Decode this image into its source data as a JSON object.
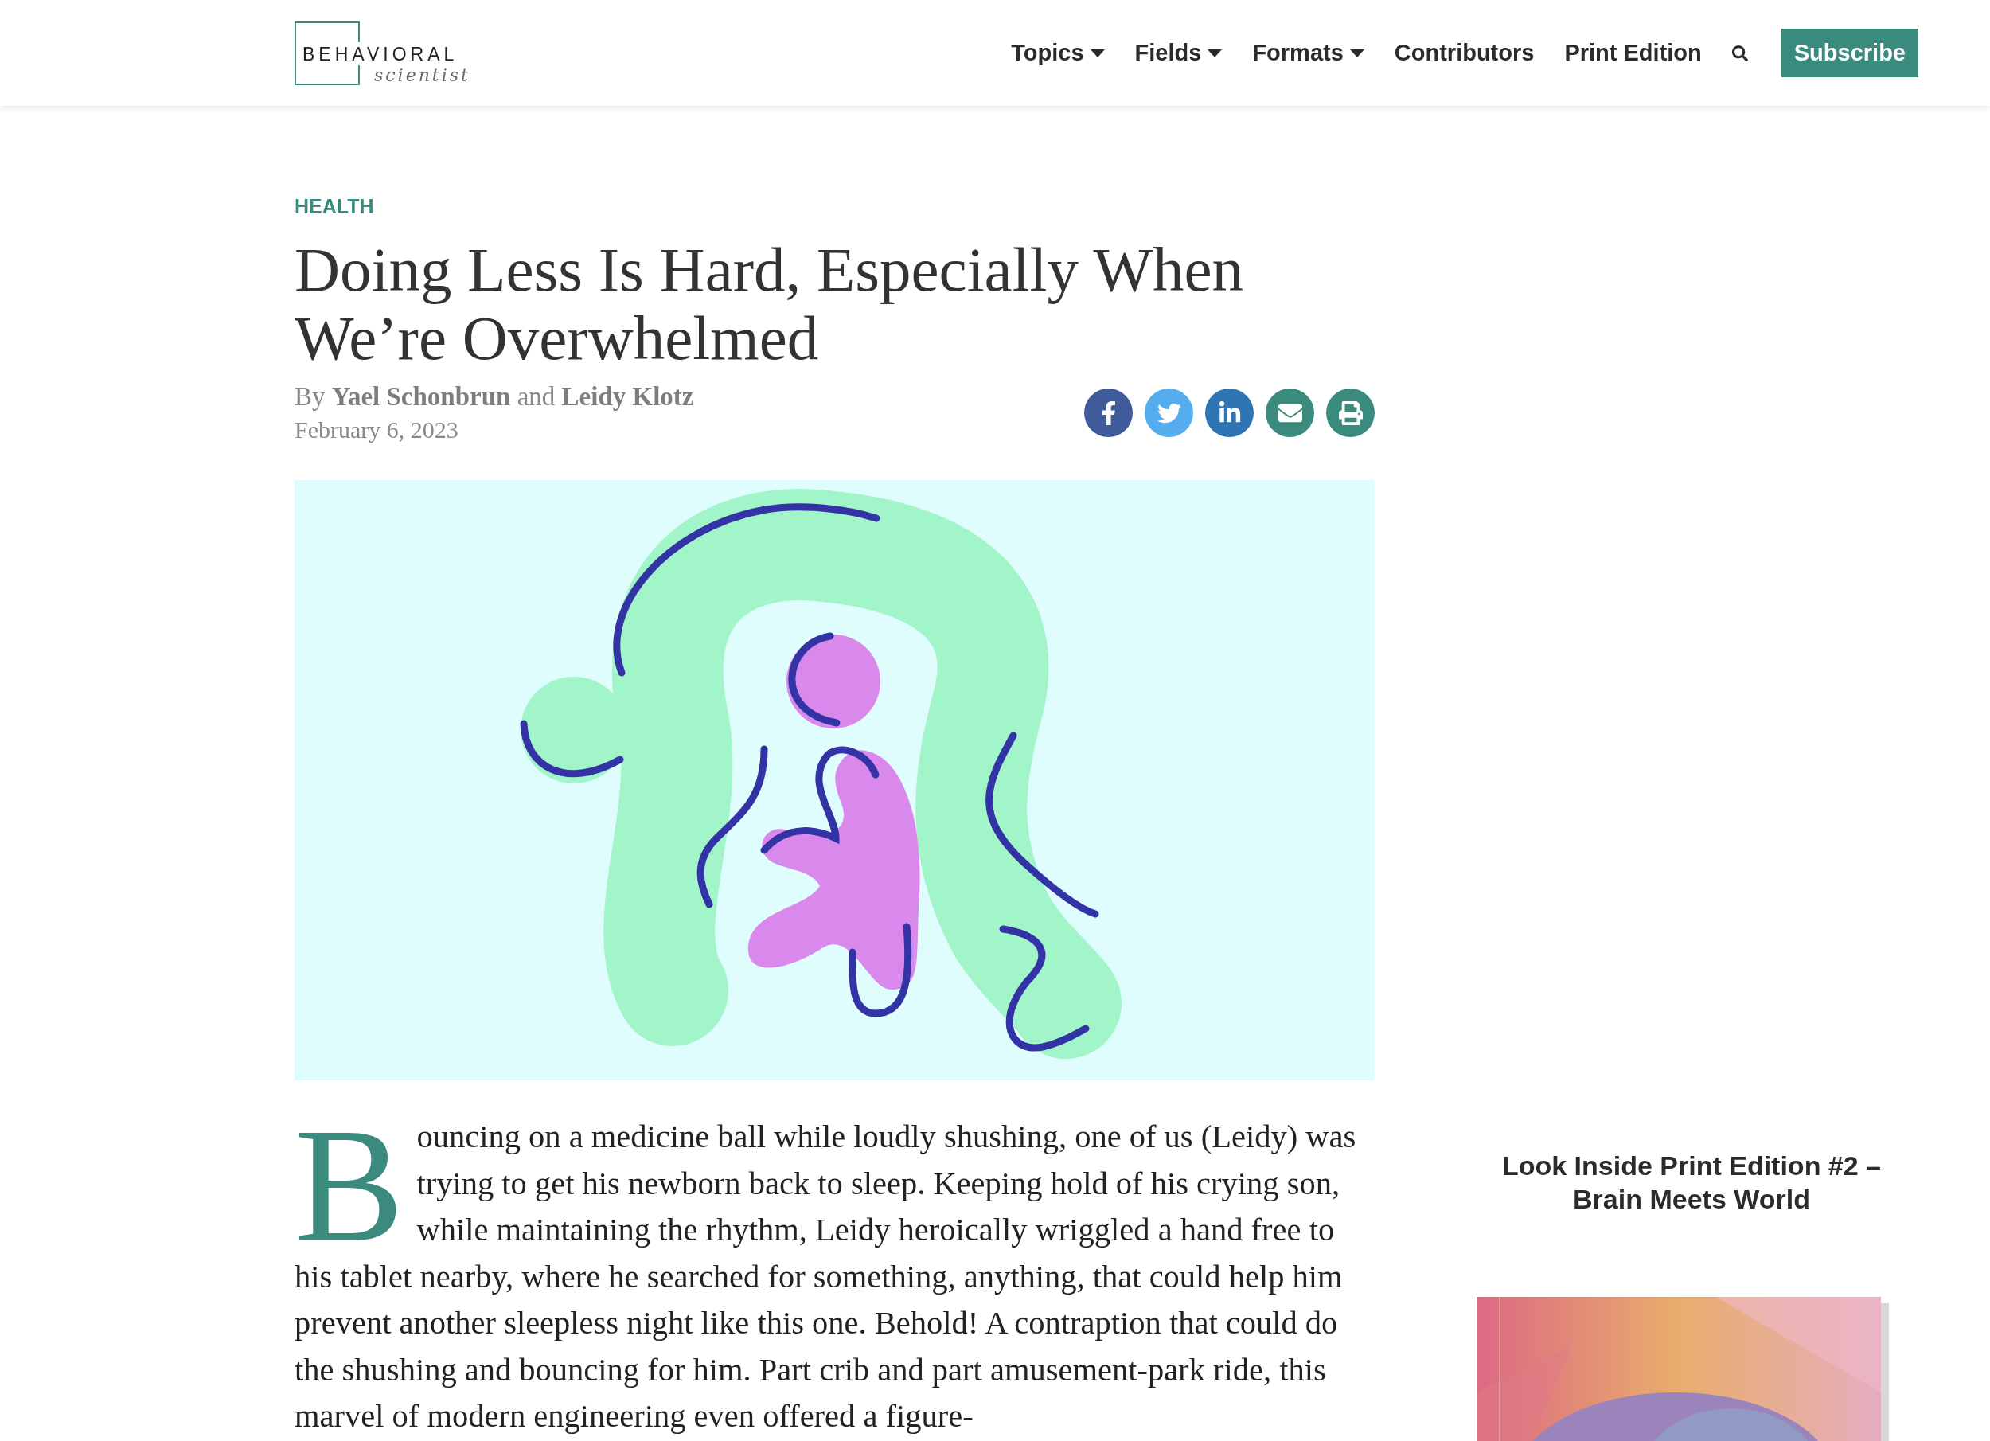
{
  "header": {
    "logo": {
      "line1": "BEHAVIORAL",
      "line2": "scientist"
    },
    "nav": [
      {
        "label": "Topics",
        "has_menu": true
      },
      {
        "label": "Fields",
        "has_menu": true
      },
      {
        "label": "Formats",
        "has_menu": true
      },
      {
        "label": "Contributors",
        "has_menu": false
      },
      {
        "label": "Print Edition",
        "has_menu": false
      }
    ],
    "subscribe": "Subscribe"
  },
  "article": {
    "category": "HEALTH",
    "title": "Doing Less Is Hard, Especially When We’re Overwhelmed",
    "byline": {
      "by": "By",
      "authors": [
        "Yael Schonbrun",
        "Leidy Klotz"
      ],
      "joiner": "and"
    },
    "date": "February 6, 2023",
    "share": [
      {
        "kind": "facebook",
        "color": "#3f5b99"
      },
      {
        "kind": "twitter",
        "color": "#55aded"
      },
      {
        "kind": "linkedin",
        "color": "#2f74b3"
      },
      {
        "kind": "email",
        "color": "#3a8a7e"
      },
      {
        "kind": "print",
        "color": "#3a8a7e"
      }
    ],
    "drop_cap": "B",
    "body": "ouncing on a medicine ball while loudly shushing, one of us (Leidy) was trying to get his newborn back to sleep. Keeping hold of his crying son, while maintaining the rhythm, Leidy heroically wriggled a hand free to his tablet nearby, where he searched for something, anything, that could help him prevent another sleepless night like this one. Behold! A contraption that could do the shushing and bouncing for him. Part crib and part amusement-park ride, this marvel of modern engineering even offered a figure-"
  },
  "sidebar": {
    "promo_title": "Look Inside Print Edition #2 – Brain Meets World"
  }
}
